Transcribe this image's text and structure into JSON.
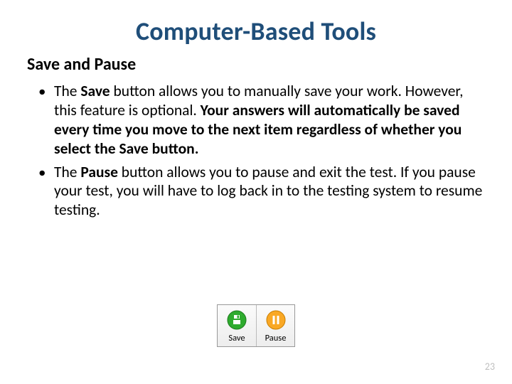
{
  "title": "Computer-Based Tools",
  "subtitle": "Save and Pause",
  "bullets": [
    {
      "pre": "The ",
      "bold1": "Save",
      "mid": " button allows you to manually save your work. However, this feature is optional. ",
      "bold2": "Your answers will automatically be saved every time you move to the next item regardless of whether you select the Save button.",
      "post": ""
    },
    {
      "pre": "The ",
      "bold1": "Pause",
      "mid": " button allows you to pause and exit the test. If you pause your test, you will have to log back in to the testing system to resume testing.",
      "bold2": "",
      "post": ""
    }
  ],
  "buttons": {
    "save": "Save",
    "pause": "Pause"
  },
  "page_number": "23"
}
